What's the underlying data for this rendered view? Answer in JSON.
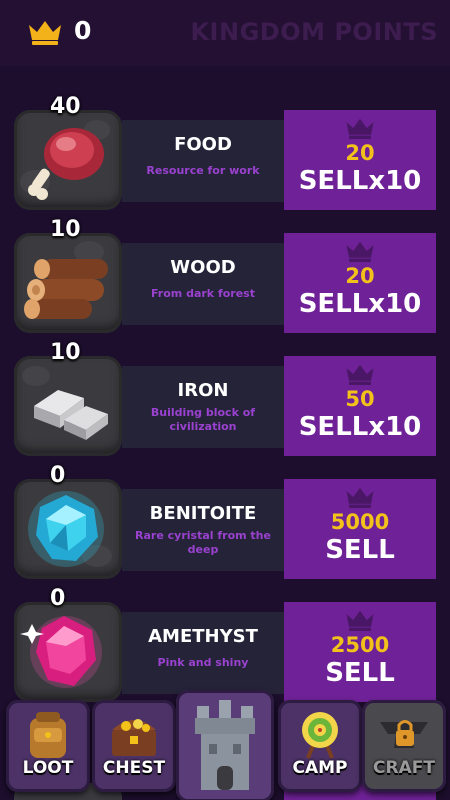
{
  "header": {
    "points": "0",
    "title": "KINGDOM POINTS",
    "crown_icon": "crown-icon",
    "accent": "#f3b21a"
  },
  "resources": [
    {
      "icon": "meat-icon",
      "count": "40",
      "name": "FOOD",
      "desc": "Resource for work",
      "price": "20",
      "sell": "SELLx10"
    },
    {
      "icon": "log-icon",
      "count": "10",
      "name": "WOOD",
      "desc": "From dark forest",
      "price": "20",
      "sell": "SELLx10"
    },
    {
      "icon": "iron-ingot-icon",
      "count": "10",
      "name": "IRON",
      "desc": "Building block of civilization",
      "price": "50",
      "sell": "SELLx10"
    },
    {
      "icon": "blue-gem-icon",
      "count": "0",
      "name": "BENITOITE",
      "desc": "Rare cyristal from the deep",
      "price": "5000",
      "sell": "SELL"
    },
    {
      "icon": "pink-gem-icon",
      "count": "0",
      "name": "AMETHYST",
      "desc": "Pink and shiny",
      "price": "2500",
      "sell": "SELL"
    }
  ],
  "nav": {
    "loot": "LOOT",
    "chest": "CHEST",
    "camp": "CAMP",
    "craft": "CRAFT"
  },
  "colors": {
    "sell_panel": "#6f2297",
    "price": "#f3c21a",
    "description": "#9a42cf"
  }
}
